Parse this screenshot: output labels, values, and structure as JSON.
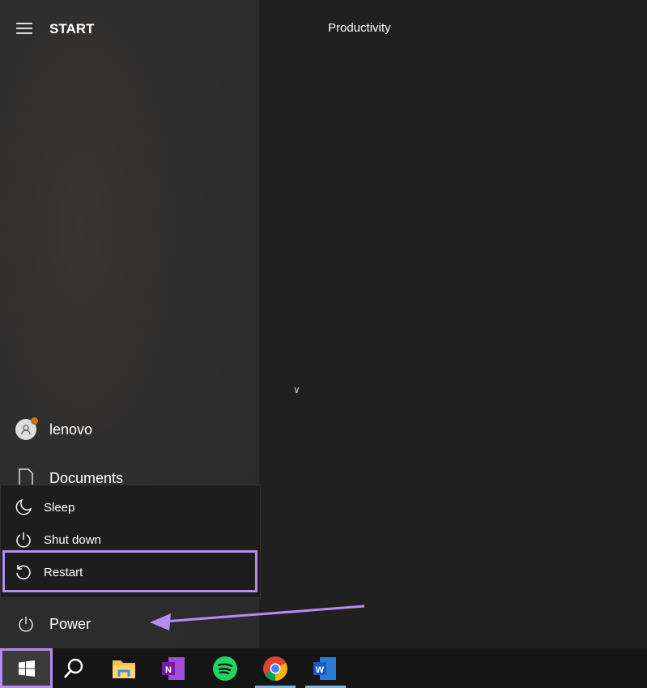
{
  "header": {
    "title": "START",
    "group": "Productivity"
  },
  "user": {
    "name": "lenovo"
  },
  "documents": {
    "label": "Documents"
  },
  "power_menu": {
    "items": [
      {
        "label": "Sleep",
        "icon": "moon-icon"
      },
      {
        "label": "Shut down",
        "icon": "power-icon"
      },
      {
        "label": "Restart",
        "icon": "restart-icon"
      }
    ]
  },
  "power": {
    "label": "Power"
  },
  "taskbar": {
    "apps": [
      "Start",
      "Search",
      "File Explorer",
      "OneNote",
      "Spotify",
      "Chrome",
      "Word"
    ]
  },
  "colors": {
    "highlight": "#b48df0"
  }
}
